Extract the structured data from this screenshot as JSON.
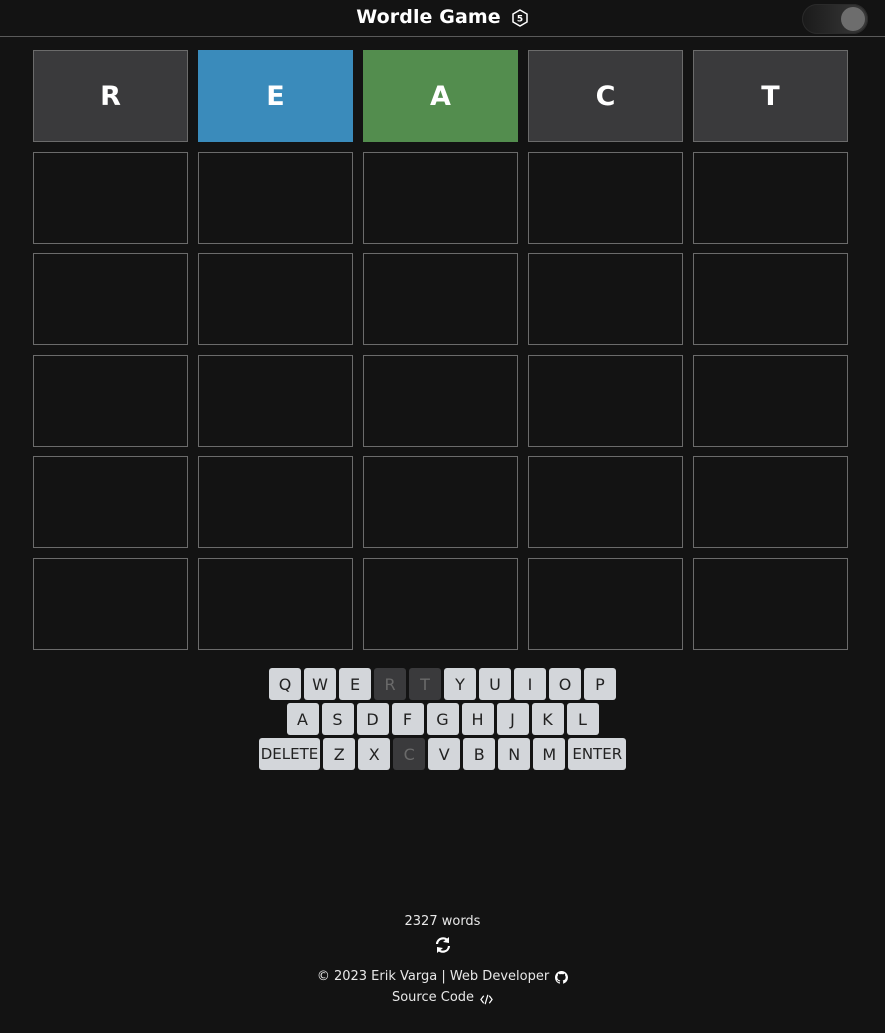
{
  "header": {
    "title": "Wordle Game",
    "five_badge": "5"
  },
  "board": {
    "rows": [
      [
        {
          "letter": "R",
          "state": "absent"
        },
        {
          "letter": "E",
          "state": "present"
        },
        {
          "letter": "A",
          "state": "correct"
        },
        {
          "letter": "C",
          "state": "absent"
        },
        {
          "letter": "T",
          "state": "absent"
        }
      ],
      [
        {
          "letter": "",
          "state": "empty"
        },
        {
          "letter": "",
          "state": "empty"
        },
        {
          "letter": "",
          "state": "empty"
        },
        {
          "letter": "",
          "state": "empty"
        },
        {
          "letter": "",
          "state": "empty"
        }
      ],
      [
        {
          "letter": "",
          "state": "empty"
        },
        {
          "letter": "",
          "state": "empty"
        },
        {
          "letter": "",
          "state": "empty"
        },
        {
          "letter": "",
          "state": "empty"
        },
        {
          "letter": "",
          "state": "empty"
        }
      ],
      [
        {
          "letter": "",
          "state": "empty"
        },
        {
          "letter": "",
          "state": "empty"
        },
        {
          "letter": "",
          "state": "empty"
        },
        {
          "letter": "",
          "state": "empty"
        },
        {
          "letter": "",
          "state": "empty"
        }
      ],
      [
        {
          "letter": "",
          "state": "empty"
        },
        {
          "letter": "",
          "state": "empty"
        },
        {
          "letter": "",
          "state": "empty"
        },
        {
          "letter": "",
          "state": "empty"
        },
        {
          "letter": "",
          "state": "empty"
        }
      ],
      [
        {
          "letter": "",
          "state": "empty"
        },
        {
          "letter": "",
          "state": "empty"
        },
        {
          "letter": "",
          "state": "empty"
        },
        {
          "letter": "",
          "state": "empty"
        },
        {
          "letter": "",
          "state": "empty"
        }
      ]
    ]
  },
  "keyboard": {
    "rows": [
      [
        {
          "label": "Q",
          "state": "unused"
        },
        {
          "label": "W",
          "state": "unused"
        },
        {
          "label": "E",
          "state": "unused"
        },
        {
          "label": "R",
          "state": "absent"
        },
        {
          "label": "T",
          "state": "absent"
        },
        {
          "label": "Y",
          "state": "unused"
        },
        {
          "label": "U",
          "state": "unused"
        },
        {
          "label": "I",
          "state": "unused"
        },
        {
          "label": "O",
          "state": "unused"
        },
        {
          "label": "P",
          "state": "unused"
        }
      ],
      [
        {
          "label": "A",
          "state": "unused"
        },
        {
          "label": "S",
          "state": "unused"
        },
        {
          "label": "D",
          "state": "unused"
        },
        {
          "label": "F",
          "state": "unused"
        },
        {
          "label": "G",
          "state": "unused"
        },
        {
          "label": "H",
          "state": "unused"
        },
        {
          "label": "J",
          "state": "unused"
        },
        {
          "label": "K",
          "state": "unused"
        },
        {
          "label": "L",
          "state": "unused"
        }
      ],
      [
        {
          "label": "DELETE",
          "state": "unused",
          "wide": true
        },
        {
          "label": "Z",
          "state": "unused"
        },
        {
          "label": "X",
          "state": "unused"
        },
        {
          "label": "C",
          "state": "absent"
        },
        {
          "label": "V",
          "state": "unused"
        },
        {
          "label": "B",
          "state": "unused"
        },
        {
          "label": "N",
          "state": "unused"
        },
        {
          "label": "M",
          "state": "unused"
        },
        {
          "label": "ENTER",
          "state": "unused",
          "wide": true
        }
      ]
    ]
  },
  "footer": {
    "word_count": "2327 words",
    "credit": "© 2023 Erik Varga | Web Developer",
    "source_code": "Source Code"
  },
  "colors": {
    "background": "#131313",
    "absent": "#3a3a3c",
    "present": "#3a8bbb",
    "correct": "#538d4e",
    "key": "#d3d6da"
  }
}
